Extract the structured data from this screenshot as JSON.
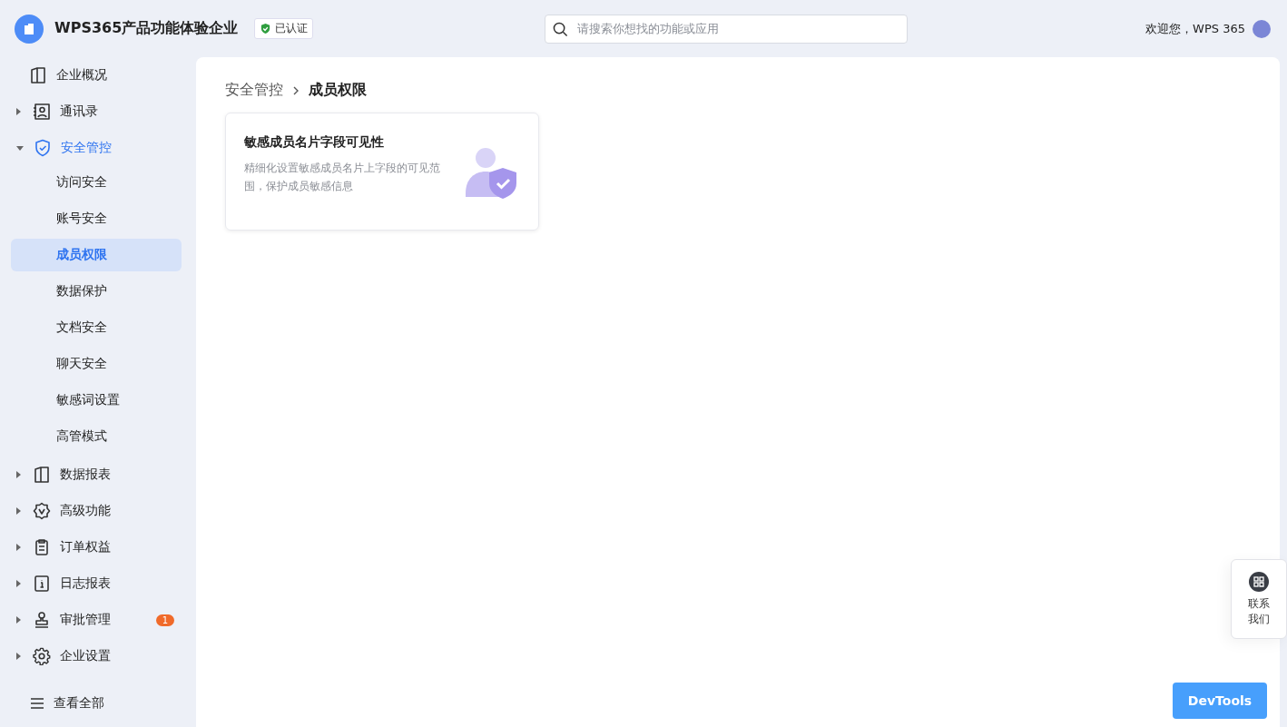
{
  "header": {
    "org_name": "WPS365产品功能体验企业",
    "verified_badge": "已认证",
    "search": {
      "placeholder": "请搜索你想找的功能或应用"
    },
    "welcome": "欢迎您，WPS 365"
  },
  "sidebar": {
    "items": [
      {
        "label": "企业概况",
        "expandable": false,
        "expanded": false,
        "active": false
      },
      {
        "label": "通讯录",
        "expandable": true,
        "expanded": false,
        "active": false
      },
      {
        "label": "安全管控",
        "expandable": true,
        "expanded": true,
        "active": true,
        "children": [
          {
            "label": "访问安全",
            "selected": false
          },
          {
            "label": "账号安全",
            "selected": false
          },
          {
            "label": "成员权限",
            "selected": true
          },
          {
            "label": "数据保护",
            "selected": false
          },
          {
            "label": "文档安全",
            "selected": false
          },
          {
            "label": "聊天安全",
            "selected": false
          },
          {
            "label": "敏感词设置",
            "selected": false
          },
          {
            "label": "高管模式",
            "selected": false
          }
        ]
      },
      {
        "label": "数据报表",
        "expandable": true,
        "expanded": false,
        "active": false
      },
      {
        "label": "高级功能",
        "expandable": true,
        "expanded": false,
        "active": false
      },
      {
        "label": "订单权益",
        "expandable": true,
        "expanded": false,
        "active": false
      },
      {
        "label": "日志报表",
        "expandable": true,
        "expanded": false,
        "active": false
      },
      {
        "label": "审批管理",
        "expandable": true,
        "expanded": false,
        "active": false,
        "badge": "1"
      },
      {
        "label": "企业设置",
        "expandable": true,
        "expanded": false,
        "active": false
      }
    ],
    "view_all": "查看全部"
  },
  "breadcrumb": [
    {
      "label": "安全管控",
      "current": false
    },
    {
      "label": "成员权限",
      "current": true
    }
  ],
  "cards": [
    {
      "title": "敏感成员名片字段可见性",
      "description": "精细化设置敏感成员名片上字段的可见范围，保护成员敏感信息"
    }
  ],
  "contact_button": {
    "label": "联系我们"
  },
  "devtools_button": "DevTools"
}
